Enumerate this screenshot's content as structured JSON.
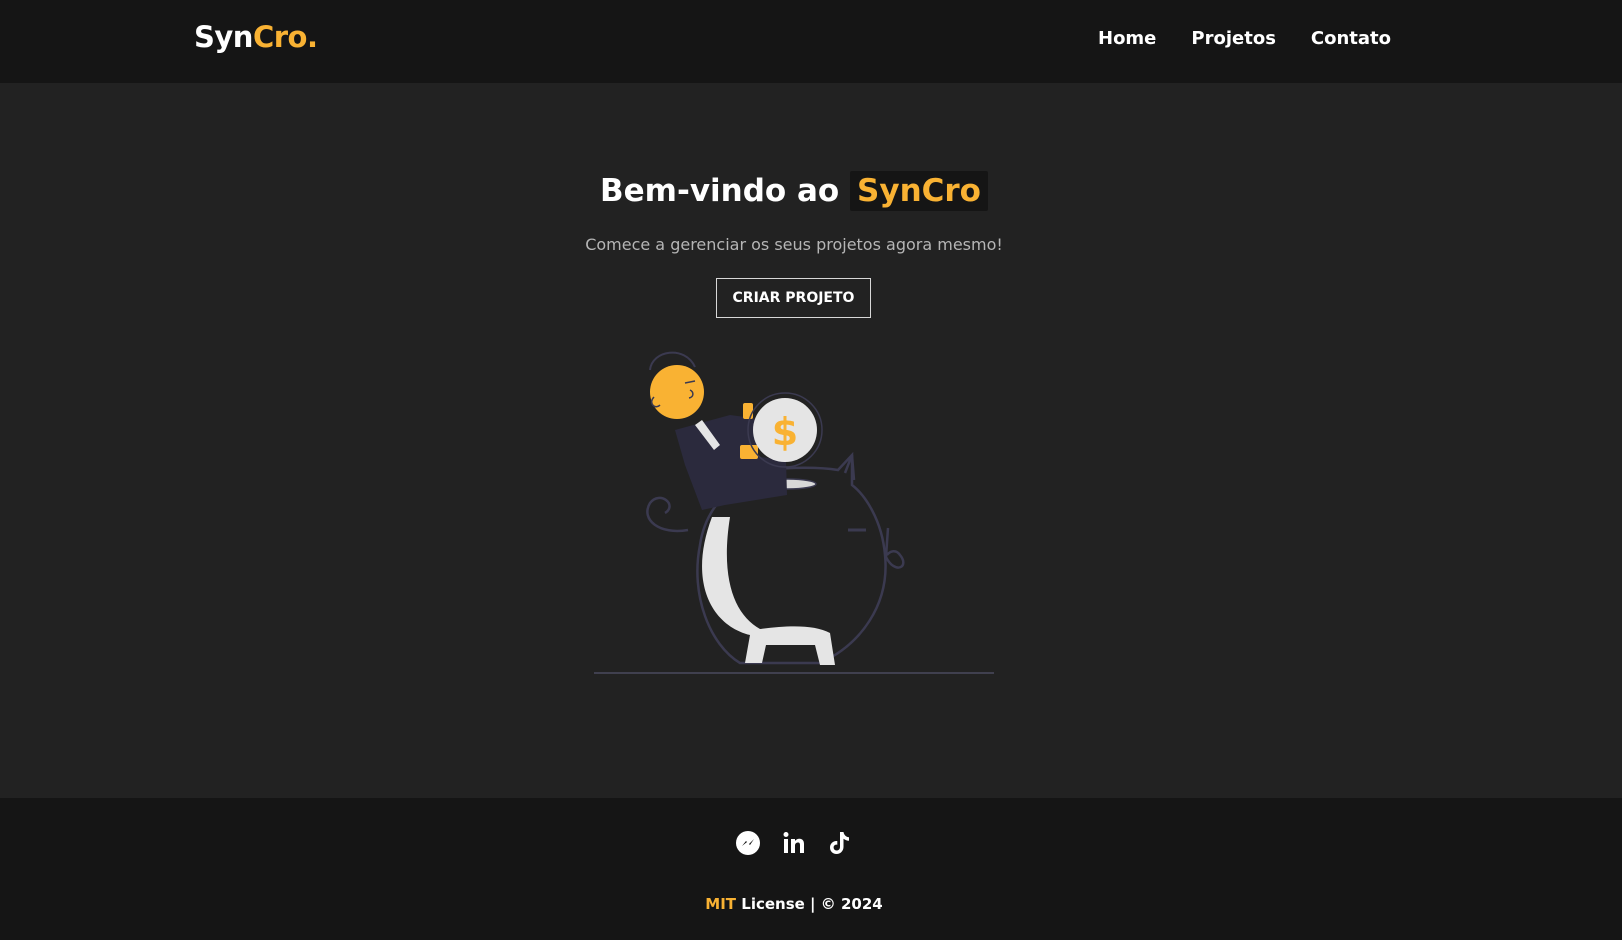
{
  "brand": {
    "name_main": "Syn",
    "name_accent": "Cro."
  },
  "nav": {
    "items": [
      "Home",
      "Projetos",
      "Contato"
    ]
  },
  "hero": {
    "title_prefix": "Bem-vindo ao",
    "title_highlight": "SynCro",
    "subtitle": "Comece a gerenciar os seus projetos agora mesmo!",
    "cta_label": "CRIAR PROJETO"
  },
  "illustration": {
    "coin_symbol": "$"
  },
  "footer": {
    "social_icons": [
      "messenger-icon",
      "linkedin-icon",
      "tiktok-icon"
    ],
    "license_accent": "MIT",
    "license_text": "License | © 2024"
  },
  "colors": {
    "accent": "#f9b233",
    "background": "#222222",
    "bar_background": "#151515",
    "text": "#ffffff",
    "muted_text": "#b5b5b5"
  }
}
